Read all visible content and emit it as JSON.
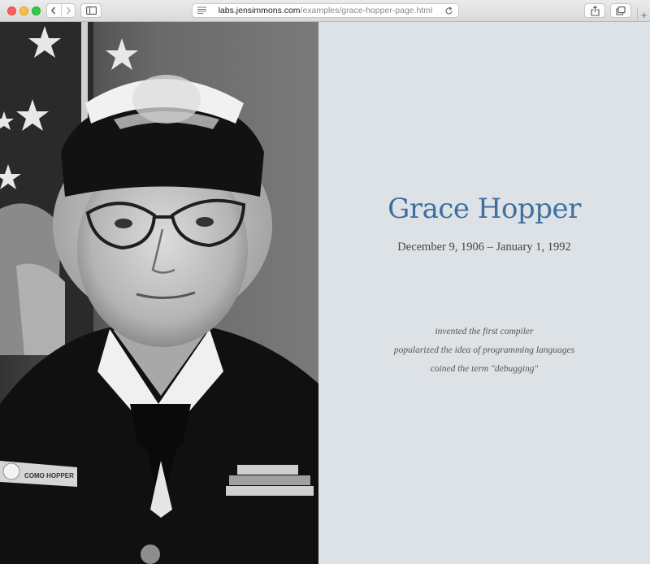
{
  "browser": {
    "url_host": "labs.jensimmons.com",
    "url_path": "/examples/grace-hopper-page.html",
    "new_tab_label": "+"
  },
  "icons": {
    "close": "close-icon",
    "minimize": "minimize-icon",
    "zoom": "zoom-icon",
    "back": "chevron-left-icon",
    "forward": "chevron-right-icon",
    "sidebar": "sidebar-icon",
    "reader": "reader-icon",
    "reload": "reload-icon",
    "share": "share-icon",
    "tabs": "tabs-icon"
  },
  "page": {
    "name": "Grace Hopper",
    "dates": "December 9, 1906 – January 1, 1992",
    "achievements": [
      "invented the first compiler",
      "popularized the idea of programming languages",
      "coined the term \"debugging\""
    ],
    "portrait": {
      "name_tag": "COMO HOPPER"
    }
  },
  "colors": {
    "title": "#3f6f9e",
    "info_background": "#dde2e7",
    "dates_text": "#444444",
    "achievement_text": "#555555"
  }
}
